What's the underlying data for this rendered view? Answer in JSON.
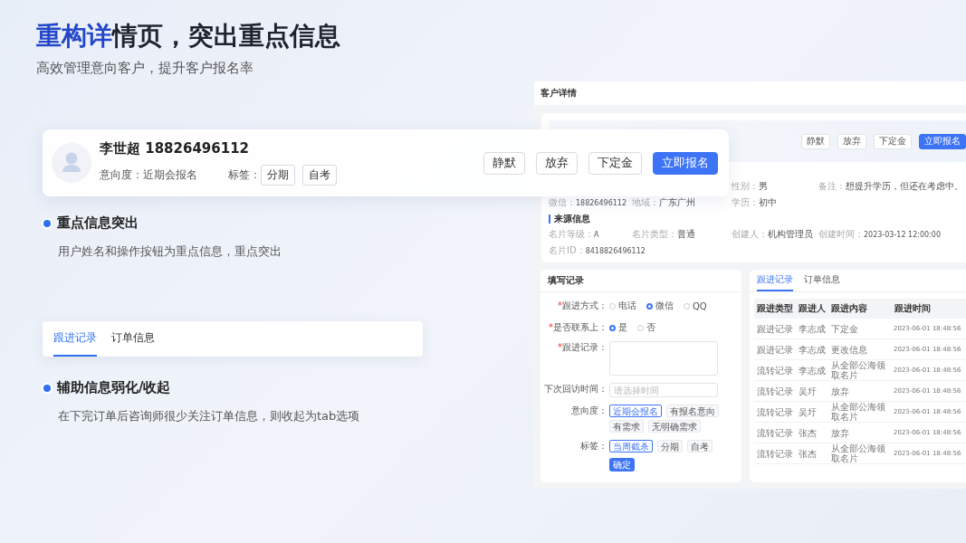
{
  "header": {
    "title_highlight": "重构详",
    "title_rest": "情页，突出重点信息",
    "subtitle": "高效管理意向客户，提升客户报名率"
  },
  "customer_card": {
    "name_phone": "李世超 18826496112",
    "intent_label": "意向度：",
    "intent": "近期会报名",
    "tags_label": "标签：",
    "tags": [
      "分期",
      "自考"
    ],
    "actions": [
      {
        "label": "静默",
        "primary": false
      },
      {
        "label": "放弃",
        "primary": false
      },
      {
        "label": "下定金",
        "primary": false
      },
      {
        "label": "立即报名",
        "primary": true
      }
    ]
  },
  "points": [
    {
      "title": "重点信息突出",
      "desc": "用户姓名和操作按钮为重点信息，重点突出"
    },
    {
      "title": "辅助信息弱化/收起",
      "desc": "在下完订单后咨询师很少关注订单信息，则收起为tab选项"
    }
  ],
  "tab_card": {
    "tabs": [
      {
        "label": "跟进记录",
        "selected": true
      },
      {
        "label": "订单信息",
        "selected": false
      }
    ]
  },
  "mockup": {
    "title": "客户详情",
    "actions": [
      {
        "label": "静默",
        "primary": false
      },
      {
        "label": "放弃",
        "primary": false
      },
      {
        "label": "下定金",
        "primary": false
      },
      {
        "label": "立即报名",
        "primary": true
      }
    ],
    "basic_rows": [
      [
        {
          "label": "性别：",
          "value": "男"
        },
        {
          "label": "备注：",
          "value": "想提升学历，但还在考虑中。"
        }
      ],
      [
        {
          "label": "微信：",
          "value": "18826496112"
        },
        {
          "label": "地域：",
          "value": "广东广州"
        },
        {
          "label": "学历：",
          "value": "初中"
        }
      ]
    ],
    "source_title": "来源信息",
    "source_rows": [
      [
        {
          "label": "名片等级：",
          "value": "A"
        },
        {
          "label": "名片类型：",
          "value": "普通"
        },
        {
          "label": "创建人：",
          "value": "机构管理员"
        },
        {
          "label": "创建时间：",
          "value": "2023-03-12 12:00:00"
        }
      ],
      [
        {
          "label": "名片ID：",
          "value": "8418826496112"
        }
      ]
    ],
    "form": {
      "title": "填写记录",
      "rows": [
        {
          "kind": "radio",
          "mark": "*",
          "label": "跟进方式：",
          "options": [
            {
              "label": "电话",
              "selected": false
            },
            {
              "label": "微信",
              "selected": true
            },
            {
              "label": "QQ",
              "selected": false
            }
          ]
        },
        {
          "kind": "radio",
          "mark": "*",
          "label": "是否联系上：",
          "options": [
            {
              "label": "是",
              "selected": true
            },
            {
              "label": "否",
              "selected": false
            }
          ]
        },
        {
          "kind": "textarea",
          "mark": "*",
          "label": "跟进记录："
        },
        {
          "kind": "date",
          "label": "下次回访时间：",
          "placeholder": "请选择时间"
        },
        {
          "kind": "chips",
          "label": "意向度：",
          "options": [
            {
              "label": "近期会报名",
              "selected": true
            },
            {
              "label": "有报名意向",
              "selected": false
            },
            {
              "label": "有需求",
              "selected": false
            },
            {
              "label": "无明确需求",
              "selected": false
            }
          ]
        },
        {
          "kind": "chips",
          "label": "标签：",
          "options": [
            {
              "label": "当周截杀",
              "selected": true
            },
            {
              "label": "分期",
              "selected": false
            },
            {
              "label": "自考",
              "selected": false
            }
          ]
        },
        {
          "kind": "submit",
          "label": "确定"
        }
      ]
    },
    "records": {
      "tabs": [
        {
          "label": "跟进记录",
          "selected": true
        },
        {
          "label": "订单信息",
          "selected": false
        }
      ],
      "columns": [
        "跟进类型",
        "跟进人",
        "跟进内容",
        "跟进时间"
      ],
      "rows": [
        [
          "跟进记录",
          "李志成",
          "下定金",
          "2023-06-01 18:48:56"
        ],
        [
          "跟进记录",
          "李志成",
          "更改信息",
          "2023-06-01 18:48:56"
        ],
        [
          "流转记录",
          "李志成",
          "从全部公海领取名片",
          "2023-06-01 18:48:56"
        ],
        [
          "流转记录",
          "吴圩",
          "放弃",
          "2023-06-01 18:48:56"
        ],
        [
          "流转记录",
          "吴圩",
          "从全部公海领取名片",
          "2023-06-01 18:48:56"
        ],
        [
          "流转记录",
          "张杰",
          "放弃",
          "2023-06-01 18:48:56"
        ],
        [
          "流转记录",
          "张杰",
          "从全部公海领取名片",
          "2023-06-01 18:48:56"
        ]
      ]
    }
  }
}
